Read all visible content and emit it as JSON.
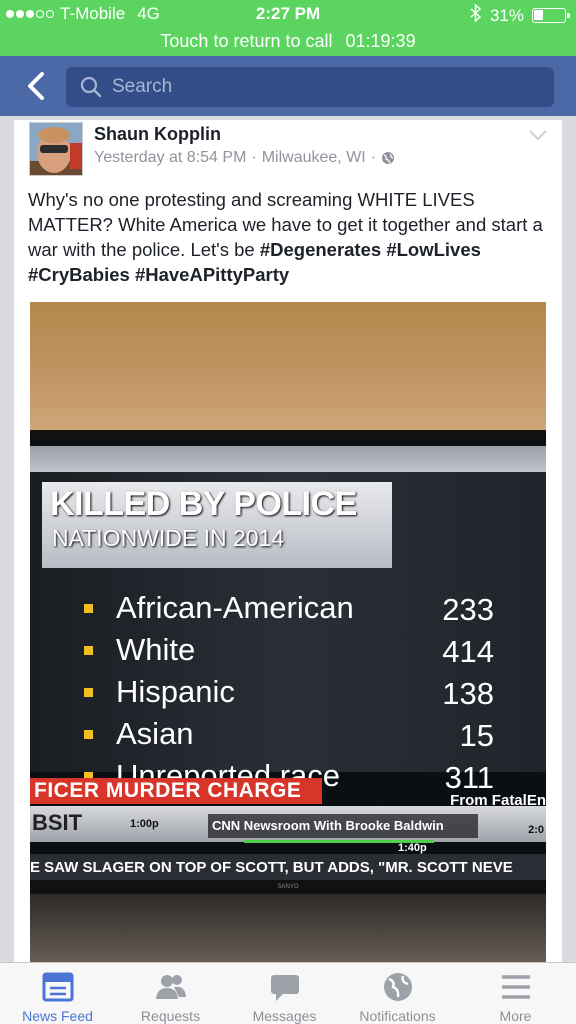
{
  "status_bar": {
    "carrier": "T-Mobile",
    "network": "4G",
    "time": "2:27 PM",
    "battery": "31%",
    "battery_level": 0.31
  },
  "call_banner": {
    "text": "Touch to return to call",
    "timer": "01:19:39"
  },
  "nav": {
    "search_placeholder": "Search"
  },
  "post": {
    "author": "Shaun Kopplin",
    "timestamp": "Yesterday at 8:54 PM",
    "location": "Milwaukee, WI",
    "separator": "·",
    "body": "Why's no one protesting and screaming WHITE LIVES MATTER? White America we have to get it together and start a war with the police. Let's be ",
    "hashtags": [
      "#Degenerates",
      "#LowLives",
      "#CryBabies",
      "#HaveAPittyParty"
    ]
  },
  "tv_graphic": {
    "headline": "KILLED BY POLICE",
    "subhead": "NATIONWIDE IN 2014",
    "rows": [
      {
        "label": "African-American",
        "value": "233"
      },
      {
        "label": "White",
        "value": "414"
      },
      {
        "label": "Hispanic",
        "value": "138"
      },
      {
        "label": "Asian",
        "value": "15"
      },
      {
        "label": "Unreported race",
        "value": "311"
      }
    ],
    "red_ticker": "FICER MURDER CHARGE",
    "source": "From FatalEn",
    "band_left": "BSIT",
    "band_time_left": "1:00p",
    "show": "CNN Newsroom With Brooke Baldwin",
    "band_time_mid": "1:40p",
    "band_time_right": "2:0",
    "crawl": "E SAW SLAGER ON TOP OF SCOTT, BUT ADDS, \"MR. SCOTT NEVE",
    "brand": "SANYO"
  },
  "tabs": [
    {
      "label": "News Feed",
      "icon": "news-feed-icon",
      "active": true
    },
    {
      "label": "Requests",
      "icon": "requests-icon",
      "active": false
    },
    {
      "label": "Messages",
      "icon": "messages-icon",
      "active": false
    },
    {
      "label": "Notifications",
      "icon": "notifications-icon",
      "active": false
    },
    {
      "label": "More",
      "icon": "more-icon",
      "active": false
    }
  ],
  "colors": {
    "status_green": "#5cd460",
    "nav_blue": "#4b69a6",
    "active_tab": "#4a74d6"
  }
}
